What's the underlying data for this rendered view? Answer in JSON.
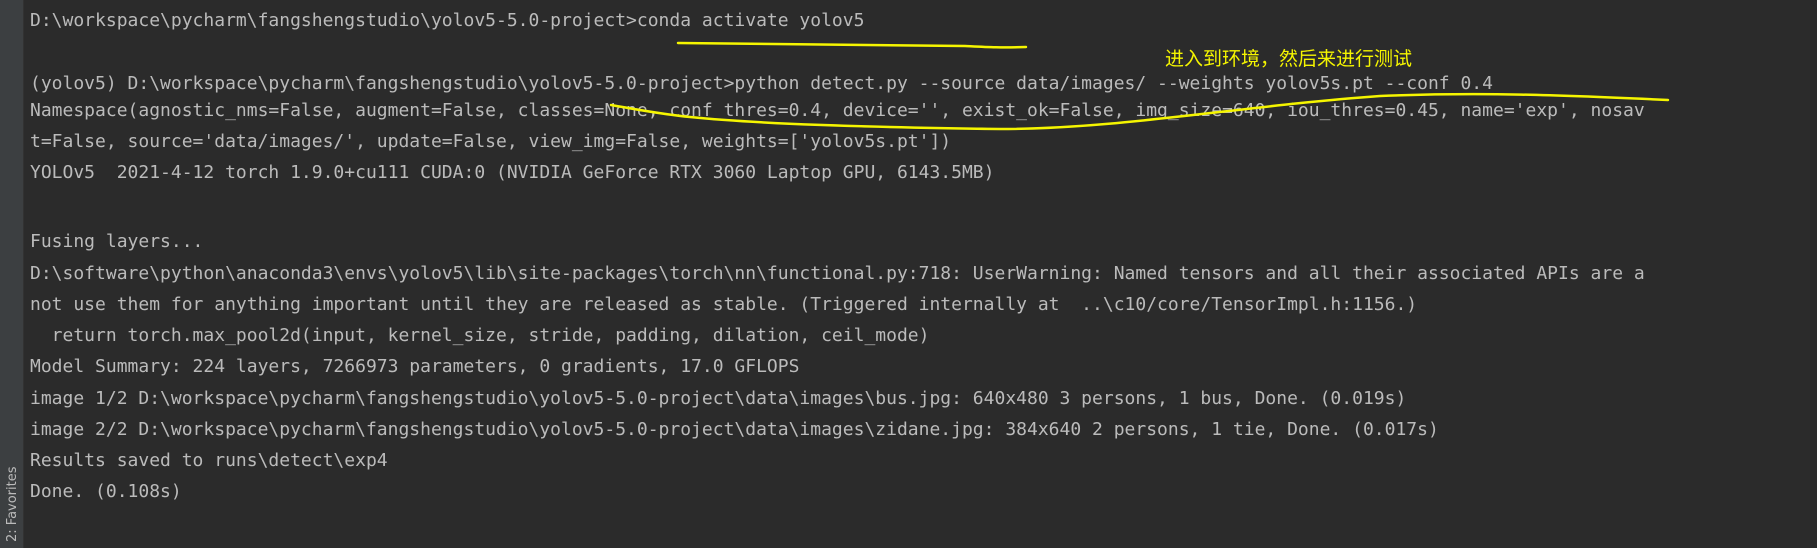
{
  "sidebar": {
    "favorites_tab": "2: Favorites"
  },
  "console": {
    "lines": [
      "D:\\workspace\\pycharm\\fangshengstudio\\yolov5-5.0-project>conda activate yolov5",
      "",
      "(yolov5) D:\\workspace\\pycharm\\fangshengstudio\\yolov5-5.0-project>python detect.py --source data/images/ --weights yolov5s.pt --conf 0.4",
      "Namespace(agnostic_nms=False, augment=False, classes=None, conf_thres=0.4, device='', exist_ok=False, img_size=640, iou_thres=0.45, name='exp', nosav",
      "t=False, source='data/images/', update=False, view_img=False, weights=['yolov5s.pt'])",
      "YOLOv5  2021-4-12 torch 1.9.0+cu111 CUDA:0 (NVIDIA GeForce RTX 3060 Laptop GPU, 6143.5MB)",
      "",
      "Fusing layers...",
      "D:\\software\\python\\anaconda3\\envs\\yolov5\\lib\\site-packages\\torch\\nn\\functional.py:718: UserWarning: Named tensors and all their associated APIs are a",
      "not use them for anything important until they are released as stable. (Triggered internally at  ..\\c10/core/TensorImpl.h:1156.)",
      "  return torch.max_pool2d(input, kernel_size, stride, padding, dilation, ceil_mode)",
      "Model Summary: 224 layers, 7266973 parameters, 0 gradients, 17.0 GFLOPS",
      "image 1/2 D:\\workspace\\pycharm\\fangshengstudio\\yolov5-5.0-project\\data\\images\\bus.jpg: 640x480 3 persons, 1 bus, Done. (0.019s)",
      "image 2/2 D:\\workspace\\pycharm\\fangshengstudio\\yolov5-5.0-project\\data\\images\\zidane.jpg: 384x640 2 persons, 1 tie, Done. (0.017s)",
      "Results saved to runs\\detect\\exp4",
      "Done. (0.108s)"
    ]
  },
  "annotation": {
    "note": "进入到环境，然后来进行测试",
    "color": "#f5f500"
  },
  "colors": {
    "background": "#2b2b2b",
    "text": "#bbbbbb",
    "gutter": "#3c3f41"
  }
}
